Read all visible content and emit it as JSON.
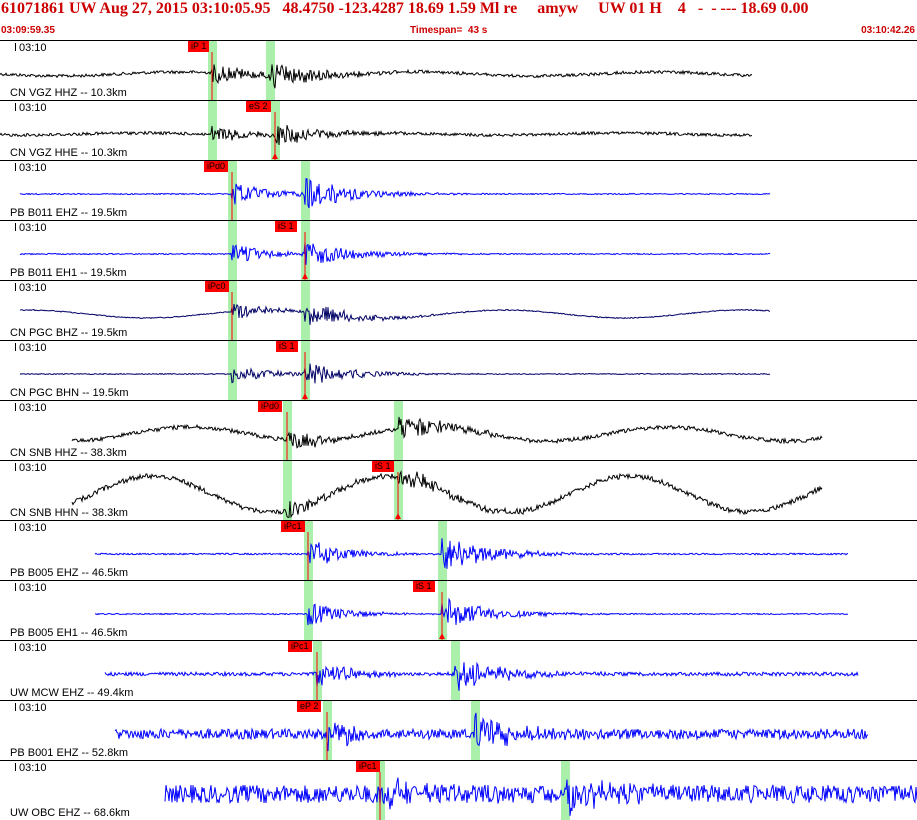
{
  "header": {
    "title": "61071861 UW Aug 27, 2015 03:10:05.95   48.4750 -123.4287 18.69 1.59 Ml re     amyw     UW 01 H    4   -  - --- 18.69 0.00",
    "start_time": "03:09:59.35",
    "timespan": "Timespan=  43 s",
    "end_time": "03:10:42.26"
  },
  "colors": {
    "header_text": "#cc0000",
    "pick_flag": "#ff0000",
    "pick_window": "#aaf0aa",
    "trace_blue": "#0000ff",
    "trace_black": "#000000",
    "trace_navy": "#000066"
  },
  "panels": [
    {
      "tick": "03:10",
      "channel": "CN VGZ HHZ -- 10.3km",
      "pick": "iP 1",
      "color": "black"
    },
    {
      "tick": "03:10",
      "channel": "CN VGZ HHE -- 10.3km",
      "pick": "eS 2",
      "color": "black"
    },
    {
      "tick": "03:10",
      "channel": "PB B011 EHZ -- 19.5km",
      "pick": "iPd0",
      "color": "blue"
    },
    {
      "tick": "03:10",
      "channel": "PB B011 EH1 -- 19.5km",
      "pick": "iS 1",
      "color": "blue"
    },
    {
      "tick": "03:10",
      "channel": "CN PGC BHZ -- 19.5km",
      "pick": "iPc0",
      "color": "navy"
    },
    {
      "tick": "03:10",
      "channel": "CN PGC BHN -- 19.5km",
      "pick": "iS 1",
      "color": "navy"
    },
    {
      "tick": "03:10",
      "channel": "CN SNB HHZ -- 38.3km",
      "pick": "iPd0",
      "color": "black"
    },
    {
      "tick": "03:10",
      "channel": "CN SNB HHN -- 38.3km",
      "pick": "iS 1",
      "color": "black"
    },
    {
      "tick": "03:10",
      "channel": "PB B005 EHZ -- 46.5km",
      "pick": "iPc1",
      "color": "blue"
    },
    {
      "tick": "03:10",
      "channel": "PB B005 EH1 -- 46.5km",
      "pick": "iS 1",
      "color": "blue"
    },
    {
      "tick": "03:10",
      "channel": "UW MCW EHZ -- 49.4km",
      "pick": "iPc1",
      "color": "blue"
    },
    {
      "tick": "03:10",
      "channel": "PB B001 EHZ -- 52.8km",
      "pick": "eP 2",
      "color": "blue"
    },
    {
      "tick": "03:10",
      "channel": "UW OBC EHZ -- 68.6km",
      "pick": "iPc1",
      "color": "blue"
    }
  ]
}
